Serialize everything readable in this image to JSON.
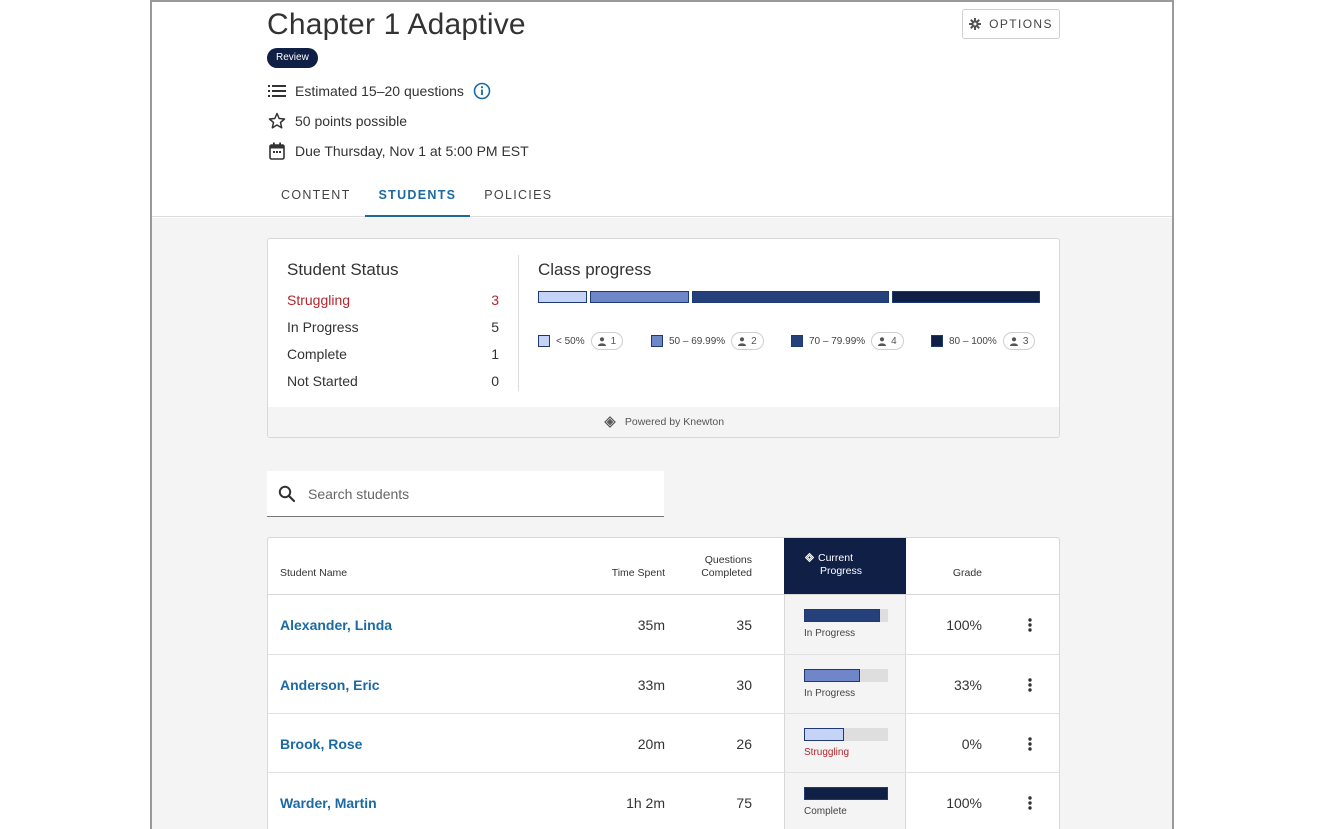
{
  "assignment": {
    "title": "Chapter 1 Adaptive",
    "badge": "Review",
    "estimated": "Estimated 15–20 questions",
    "points": "50 points possible",
    "due": "Due Thursday, Nov 1 at 5:00 PM EST",
    "options_label": "OPTIONS"
  },
  "tabs": [
    {
      "label": "CONTENT",
      "active": false
    },
    {
      "label": "STUDENTS",
      "active": true
    },
    {
      "label": "POLICIES",
      "active": false
    }
  ],
  "student_status": {
    "title": "Student Status",
    "rows": [
      {
        "label": "Struggling",
        "count": "3"
      },
      {
        "label": "In Progress",
        "count": "5"
      },
      {
        "label": "Complete",
        "count": "1"
      },
      {
        "label": "Not Started",
        "count": "0"
      }
    ]
  },
  "class_progress": {
    "title": "Class progress",
    "buckets": [
      {
        "range": "< 50%",
        "count": "1",
        "color": "#c5d3f7"
      },
      {
        "range": "50 – 69.99%",
        "count": "2",
        "color": "#6f86c8"
      },
      {
        "range": "70 – 79.99%",
        "count": "4",
        "color": "#25407a"
      },
      {
        "range": "80 – 100%",
        "count": "3",
        "color": "#0f1f45"
      }
    ],
    "powered_by": "Powered by Knewton"
  },
  "search": {
    "placeholder": "Search students"
  },
  "table": {
    "headers": {
      "name": "Student Name",
      "time": "Time Spent",
      "questions_line1": "Questions",
      "questions_line2": "Completed",
      "progress_line1": "Current",
      "progress_line2": "Progress",
      "grade": "Grade"
    },
    "rows": [
      {
        "name": "Alexander, Linda",
        "time": "35m",
        "questions": "35",
        "progress": 0.9,
        "progress_color": "#25407a",
        "status": "In Progress",
        "grade": "100%"
      },
      {
        "name": "Anderson, Eric",
        "time": "33m",
        "questions": "30",
        "progress": 0.67,
        "progress_color": "#6f86c8",
        "status": "In Progress",
        "grade": "33%"
      },
      {
        "name": "Brook, Rose",
        "time": "20m",
        "questions": "26",
        "progress": 0.48,
        "progress_color": "#c5d3f7",
        "status": "Struggling",
        "grade": "0%"
      },
      {
        "name": "Warder, Martin",
        "time": "1h 2m",
        "questions": "75",
        "progress": 1.0,
        "progress_color": "#0f1f45",
        "status": "Complete",
        "grade": "100%"
      }
    ]
  }
}
